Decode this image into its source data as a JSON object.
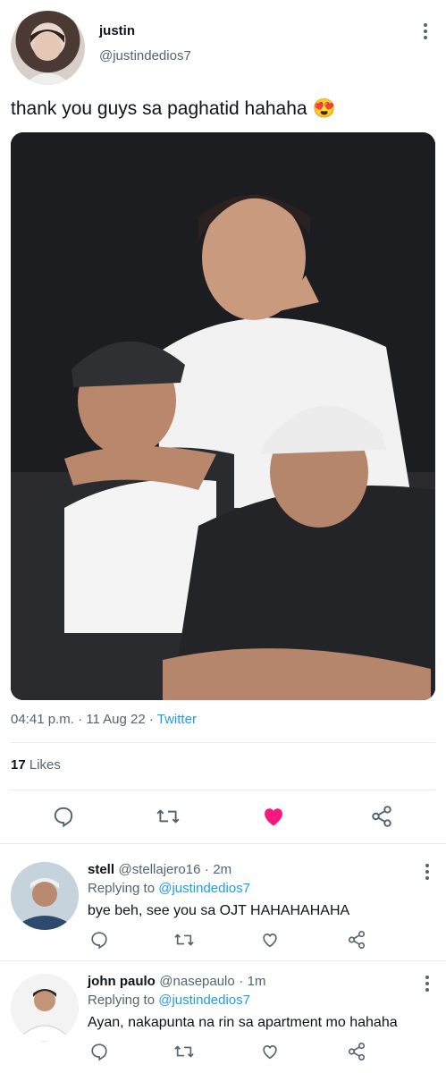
{
  "tweet": {
    "author_name": "justin",
    "author_handle": "@justindedios7",
    "text": "thank you guys sa paghatid hahaha",
    "emoji": "😍",
    "time": "04:41 p.m.",
    "date": "11 Aug 22",
    "source": "Twitter",
    "likes_count": "17",
    "likes_label": "Likes"
  },
  "colors": {
    "like_active": "#f91880",
    "link": "#1d9bf0",
    "muted": "#536471"
  },
  "replies": [
    {
      "name": "stell",
      "handle": "@stellajero16",
      "time": "2m",
      "replying_label": "Replying to",
      "replying_to": "@justindedios7",
      "text": "bye beh, see you sa OJT HAHAHAHAHA"
    },
    {
      "name": "john paulo",
      "handle": "@nasepaulo",
      "time": "1m",
      "replying_label": "Replying to",
      "replying_to": "@justindedios7",
      "text": "Ayan, nakapunta na rin sa apartment mo hahaha"
    }
  ],
  "separator": "·",
  "icons": [
    "reply-icon",
    "retweet-icon",
    "like-icon",
    "share-icon",
    "more-icon"
  ]
}
